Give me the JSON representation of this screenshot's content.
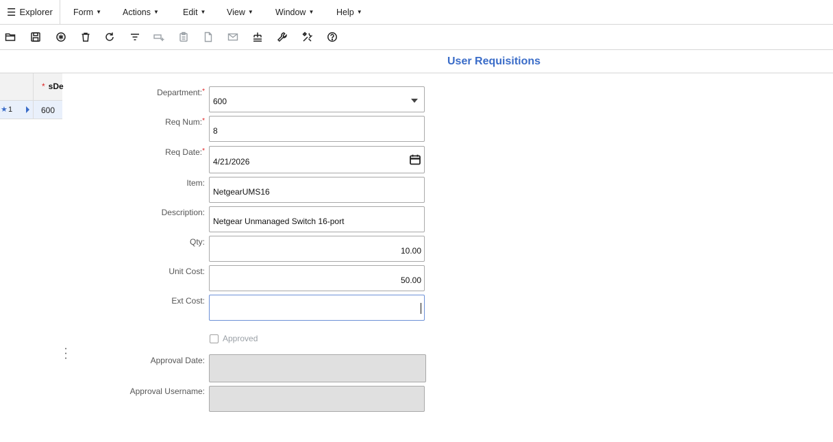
{
  "menubar": {
    "explorer": "Explorer",
    "items": [
      "Form",
      "Actions",
      "Edit",
      "View",
      "Window",
      "Help"
    ]
  },
  "toolbar": {
    "icons": [
      "open-icon",
      "save-icon",
      "new-icon",
      "delete-icon",
      "refresh-icon",
      "filter-icon",
      "insert-row-icon",
      "clipboard-icon",
      "document-icon",
      "email-icon",
      "tree-icon",
      "wrench-icon",
      "tools-icon",
      "help-icon"
    ]
  },
  "form": {
    "title": "User Requisitions",
    "fields": {
      "department": {
        "label": "Department:",
        "value": "600"
      },
      "req_num": {
        "label": "Req Num:",
        "value": "8"
      },
      "req_date": {
        "label": "Req Date:",
        "value": "4/21/2026"
      },
      "item": {
        "label": "Item:",
        "value": "NetgearUMS16"
      },
      "description": {
        "label": "Description:",
        "value": "Netgear Unmanaged Switch 16-port"
      },
      "qty": {
        "label": "Qty:",
        "value": "10.00"
      },
      "unit_cost": {
        "label": "Unit Cost:",
        "value": "50.00"
      },
      "ext_cost": {
        "label": "Ext Cost:",
        "value": ""
      },
      "approved": {
        "label": "Approved",
        "checked": false
      },
      "approval_date": {
        "label": "Approval Date:",
        "value": ""
      },
      "approval_username": {
        "label": "Approval Username:",
        "value": ""
      }
    },
    "required_marker": "*"
  },
  "grid": {
    "column_header": "sDe",
    "required_marker": "*",
    "rows": [
      {
        "num": "1",
        "value": "600"
      }
    ]
  },
  "colors": {
    "accent": "#3a6cc8",
    "required": "#d22222",
    "disabled_bg": "#e0e0e0"
  }
}
